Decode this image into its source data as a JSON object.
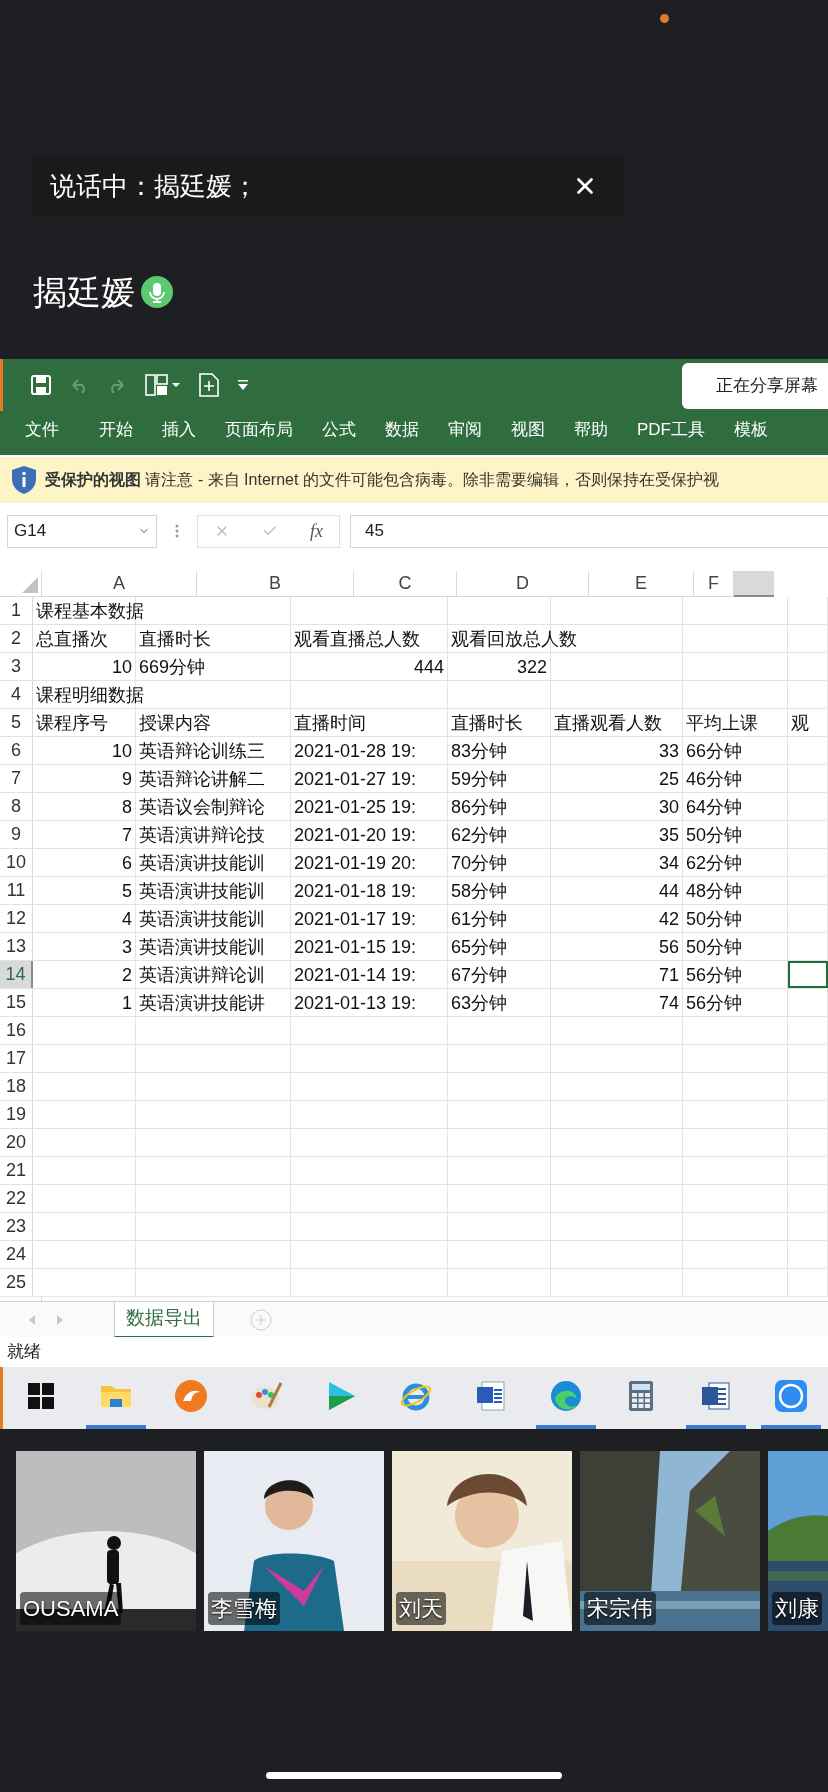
{
  "speaking_banner": {
    "text": "说话中：揭廷媛；"
  },
  "speaker": {
    "name": "揭廷媛",
    "mic_on": true
  },
  "shared_screen": {
    "share_status": "正在分享屏幕",
    "ribbon_tabs": [
      "文件",
      "开始",
      "插入",
      "页面布局",
      "公式",
      "数据",
      "审阅",
      "视图",
      "帮助",
      "PDF工具",
      "模板"
    ],
    "protected_view": "**受保护的视图** 请注意 - 来自 Internet 的文件可能包含病毒。除非需要编辑，否则保持在受保护视",
    "name_box": "G14",
    "function_label": "fx",
    "formula": "45",
    "columns": [
      "A",
      "B",
      "C",
      "D",
      "E",
      "F"
    ],
    "rows": [
      {
        "number": "1",
        "selected": false,
        "cells": [
          {
            "text": "课程基本数据",
            "kind": "text"
          }
        ]
      },
      {
        "number": "2",
        "selected": false,
        "cells": [
          {
            "text": "总直播次",
            "kind": "text"
          },
          {
            "text": "直播时长",
            "kind": "text"
          },
          {
            "text": "观看直播总人数",
            "kind": "text"
          },
          {
            "text": "观看回放总人数",
            "kind": "text"
          }
        ]
      },
      {
        "number": "3",
        "selected": false,
        "cells": [
          {
            "text": "10",
            "kind": "number"
          },
          {
            "text": "669分钟",
            "kind": "text"
          },
          {
            "text": "444",
            "kind": "number"
          },
          {
            "text": "322",
            "kind": "number"
          }
        ]
      },
      {
        "number": "4",
        "selected": false,
        "cells": [
          {
            "text": "课程明细数据",
            "kind": "text"
          }
        ]
      },
      {
        "number": "5",
        "selected": false,
        "cells": [
          {
            "text": "课程序号",
            "kind": "text"
          },
          {
            "text": "授课内容",
            "kind": "text"
          },
          {
            "text": "直播时间",
            "kind": "text"
          },
          {
            "text": "直播时长",
            "kind": "text"
          },
          {
            "text": "直播观看人数",
            "kind": "text"
          },
          {
            "text": "平均上课",
            "kind": "text"
          },
          {
            "text": "观",
            "kind": "text"
          }
        ]
      },
      {
        "number": "6",
        "selected": false,
        "cells": [
          {
            "text": "10",
            "kind": "number"
          },
          {
            "text": "英语辩论训练三",
            "kind": "text"
          },
          {
            "text": "2021-01-28 19:",
            "kind": "text"
          },
          {
            "text": "83分钟",
            "kind": "text"
          },
          {
            "text": "33",
            "kind": "number"
          },
          {
            "text": "66分钟",
            "kind": "text"
          }
        ]
      },
      {
        "number": "7",
        "selected": false,
        "cells": [
          {
            "text": "9",
            "kind": "number"
          },
          {
            "text": "英语辩论讲解二",
            "kind": "text"
          },
          {
            "text": "2021-01-27 19:",
            "kind": "text"
          },
          {
            "text": "59分钟",
            "kind": "text"
          },
          {
            "text": "25",
            "kind": "number"
          },
          {
            "text": "46分钟",
            "kind": "text"
          }
        ]
      },
      {
        "number": "8",
        "selected": false,
        "cells": [
          {
            "text": "8",
            "kind": "number"
          },
          {
            "text": "英语议会制辩论",
            "kind": "text"
          },
          {
            "text": "2021-01-25 19:",
            "kind": "text"
          },
          {
            "text": "86分钟",
            "kind": "text"
          },
          {
            "text": "30",
            "kind": "number"
          },
          {
            "text": "64分钟",
            "kind": "text"
          }
        ]
      },
      {
        "number": "9",
        "selected": false,
        "cells": [
          {
            "text": "7",
            "kind": "number"
          },
          {
            "text": "英语演讲辩论技",
            "kind": "text"
          },
          {
            "text": "2021-01-20 19:",
            "kind": "text"
          },
          {
            "text": "62分钟",
            "kind": "text"
          },
          {
            "text": "35",
            "kind": "number"
          },
          {
            "text": "50分钟",
            "kind": "text"
          }
        ]
      },
      {
        "number": "10",
        "selected": false,
        "cells": [
          {
            "text": "6",
            "kind": "number"
          },
          {
            "text": "英语演讲技能训",
            "kind": "text"
          },
          {
            "text": "2021-01-19 20:",
            "kind": "text"
          },
          {
            "text": "70分钟",
            "kind": "text"
          },
          {
            "text": "34",
            "kind": "number"
          },
          {
            "text": "62分钟",
            "kind": "text"
          }
        ]
      },
      {
        "number": "11",
        "selected": false,
        "cells": [
          {
            "text": "5",
            "kind": "number"
          },
          {
            "text": "英语演讲技能训",
            "kind": "text"
          },
          {
            "text": "2021-01-18 19:",
            "kind": "text"
          },
          {
            "text": "58分钟",
            "kind": "text"
          },
          {
            "text": "44",
            "kind": "number"
          },
          {
            "text": "48分钟",
            "kind": "text"
          }
        ]
      },
      {
        "number": "12",
        "selected": false,
        "cells": [
          {
            "text": "4",
            "kind": "number"
          },
          {
            "text": "英语演讲技能训",
            "kind": "text"
          },
          {
            "text": "2021-01-17 19:",
            "kind": "text"
          },
          {
            "text": "61分钟",
            "kind": "text"
          },
          {
            "text": "42",
            "kind": "number"
          },
          {
            "text": "50分钟",
            "kind": "text"
          }
        ]
      },
      {
        "number": "13",
        "selected": false,
        "cells": [
          {
            "text": "3",
            "kind": "number"
          },
          {
            "text": "英语演讲技能训",
            "kind": "text"
          },
          {
            "text": "2021-01-15 19:",
            "kind": "text"
          },
          {
            "text": "65分钟",
            "kind": "text"
          },
          {
            "text": "56",
            "kind": "number"
          },
          {
            "text": "50分钟",
            "kind": "text"
          }
        ]
      },
      {
        "number": "14",
        "selected": true,
        "cells": [
          {
            "text": "2",
            "kind": "number"
          },
          {
            "text": "英语演讲辩论训",
            "kind": "text"
          },
          {
            "text": "2021-01-14 19:",
            "kind": "text"
          },
          {
            "text": "67分钟",
            "kind": "text"
          },
          {
            "text": "71",
            "kind": "number"
          },
          {
            "text": "56分钟",
            "kind": "text"
          }
        ]
      },
      {
        "number": "15",
        "selected": false,
        "cells": [
          {
            "text": "1",
            "kind": "number"
          },
          {
            "text": "英语演讲技能讲",
            "kind": "text"
          },
          {
            "text": "2021-01-13 19:",
            "kind": "text"
          },
          {
            "text": "63分钟",
            "kind": "text"
          },
          {
            "text": "74",
            "kind": "number"
          },
          {
            "text": "56分钟",
            "kind": "text"
          }
        ]
      },
      {
        "number": "16",
        "selected": false,
        "cells": []
      },
      {
        "number": "17",
        "selected": false,
        "cells": []
      },
      {
        "number": "18",
        "selected": false,
        "cells": []
      },
      {
        "number": "19",
        "selected": false,
        "cells": []
      },
      {
        "number": "20",
        "selected": false,
        "cells": []
      },
      {
        "number": "21",
        "selected": false,
        "cells": []
      },
      {
        "number": "22",
        "selected": false,
        "cells": []
      },
      {
        "number": "23",
        "selected": false,
        "cells": []
      },
      {
        "number": "24",
        "selected": false,
        "cells": []
      },
      {
        "number": "25",
        "selected": false,
        "cells": []
      }
    ],
    "sheet_tabs": [
      {
        "label": "数据导出",
        "selected": true
      }
    ],
    "status": "就绪",
    "taskbar": [
      {
        "kind": "windows",
        "running": false
      },
      {
        "kind": "folder",
        "running": true
      },
      {
        "kind": "browser",
        "running": false
      },
      {
        "kind": "paint",
        "running": false
      },
      {
        "kind": "player",
        "running": false
      },
      {
        "kind": "ie",
        "running": false
      },
      {
        "kind": "word_old",
        "running": false
      },
      {
        "kind": "edge",
        "running": true
      },
      {
        "kind": "calculator",
        "running": false
      },
      {
        "kind": "word",
        "running": true
      },
      {
        "kind": "kapp",
        "running": true
      }
    ]
  },
  "participants": [
    {
      "name": "OUSAMA"
    },
    {
      "name": "李雪梅"
    },
    {
      "name": "刘天"
    },
    {
      "name": "宋宗伟"
    },
    {
      "name": "刘康"
    }
  ]
}
